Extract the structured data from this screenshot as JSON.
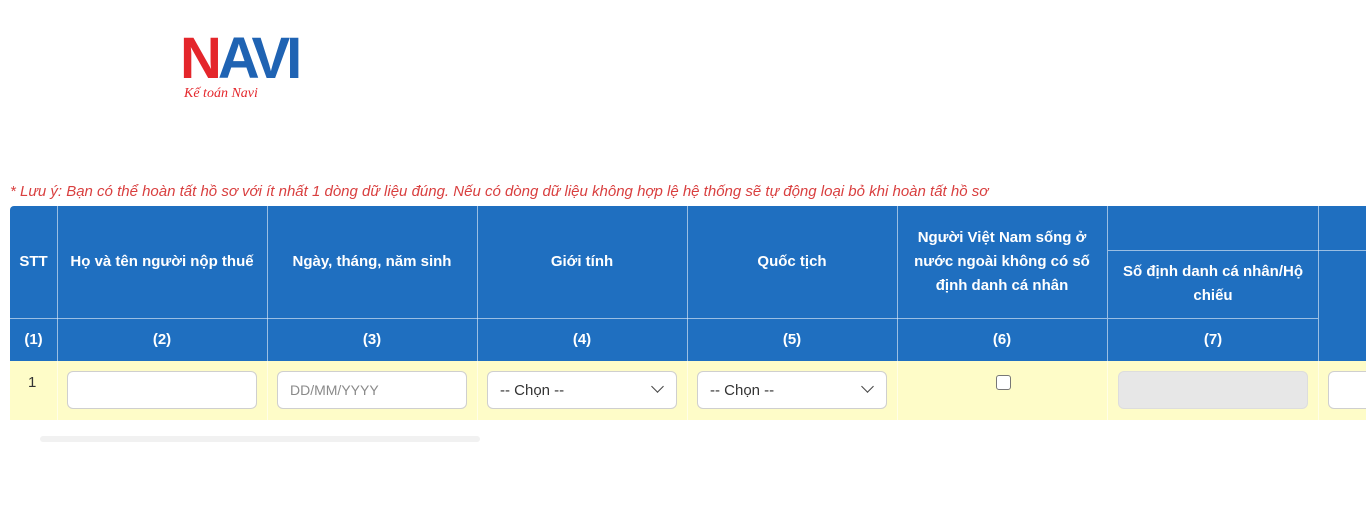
{
  "logo": {
    "mark_left": "N",
    "mark_mid": "A",
    "mark_right": "VI",
    "subtitle": "Kế toán Navi",
    "colors": {
      "red": "#e4262b",
      "blue": "#1f63b3"
    }
  },
  "note": "* Lưu ý: Bạn có thể hoàn tất hồ sơ với ít nhất 1 dòng dữ liệu đúng. Nếu có dòng dữ liệu không hợp lệ hệ thống sẽ tự động loại bỏ khi hoàn tất hồ sơ",
  "table": {
    "header_color": "#1f6fc0",
    "row_color": "#fefcc8",
    "columns": [
      {
        "label": "STT",
        "number": "(1)"
      },
      {
        "label": "Họ và tên người nộp thuế",
        "number": "(2)"
      },
      {
        "label": "Ngày, tháng, năm sinh",
        "number": "(3)"
      },
      {
        "label": "Giới tính",
        "number": "(4)"
      },
      {
        "label": "Quốc tịch",
        "number": "(5)"
      },
      {
        "label": "Người Việt Nam sống ở nước ngoài không có số định danh cá nhân",
        "number": "(6)"
      },
      {
        "label": "Số định danh cá nhân/Hộ chiếu",
        "number": "(7)"
      }
    ],
    "rows": [
      {
        "stt": "1",
        "full_name": "",
        "dob_placeholder": "DD/MM/YYYY",
        "gender_selected": "-- Chọn --",
        "nationality_selected": "-- Chọn --",
        "overseas_checked": false,
        "id_number": ""
      }
    ]
  }
}
